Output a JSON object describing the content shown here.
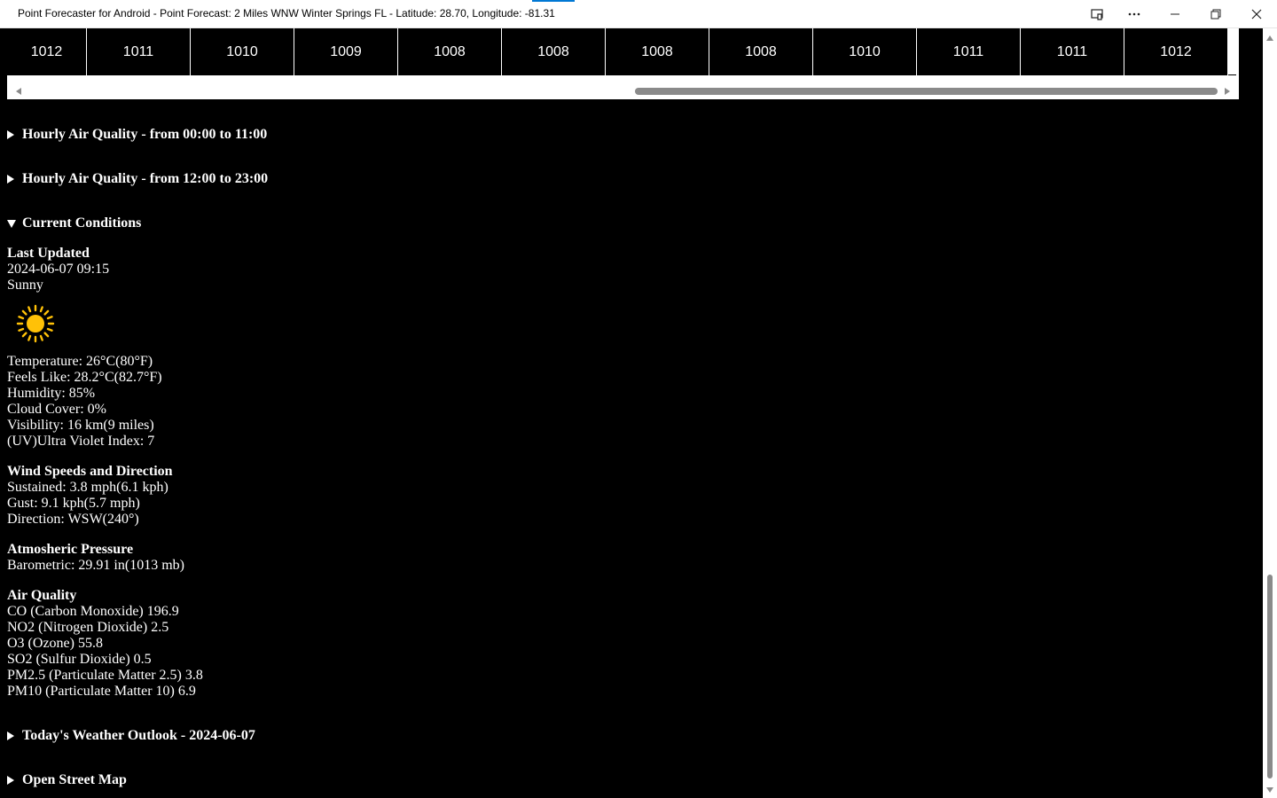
{
  "window": {
    "title": "Point Forecaster for Android - Point Forecast: 2 Miles WNW Winter Springs FL - Latitude: 28.70, Longitude: -81.31",
    "icons": [
      "cast-icon",
      "more-icon",
      "minimize-icon",
      "restore-icon",
      "close-icon"
    ]
  },
  "pressure_row": [
    "1012",
    "1011",
    "1010",
    "1009",
    "1008",
    "1008",
    "1008",
    "1008",
    "1010",
    "1011",
    "1011",
    "1012"
  ],
  "sections": {
    "air_quality_am": "Hourly Air Quality - from 00:00 to 11:00",
    "air_quality_pm": "Hourly Air Quality - from 12:00 to 23:00",
    "current_conditions": "Current Conditions",
    "outlook": "Today's Weather Outlook - 2024-06-07",
    "map": "Open Street Map"
  },
  "current": {
    "last_updated_label": "Last Updated",
    "last_updated": "2024-06-07 09:15",
    "condition": "Sunny",
    "condition_icon": "sun-icon",
    "temperature": "Temperature: 26°C(80°F)",
    "feels_like": "Feels Like: 28.2°C(82.7°F)",
    "humidity": "Humidity: 85%",
    "cloud_cover": "Cloud Cover: 0%",
    "visibility": "Visibility: 16 km(9 miles)",
    "uv": "(UV)Ultra Violet Index: 7",
    "wind_heading": "Wind Speeds and Direction",
    "sustained": "Sustained: 3.8 mph(6.1 kph)",
    "gust": "Gust: 9.1 kph(5.7 mph)",
    "direction": "Direction: WSW(240°)",
    "pressure_heading": "Atmosheric Pressure",
    "barometric": "Barometric: 29.91 in(1013 mb)",
    "aq_heading": "Air Quality",
    "co": "CO (Carbon Monoxide) 196.9",
    "no2": "NO2 (Nitrogen Dioxide) 2.5",
    "o3": "O3 (Ozone) 55.8",
    "so2": "SO2 (Sulfur Dioxide) 0.5",
    "pm25": "PM2.5 (Particulate Matter 2.5) 3.8",
    "pm10": "PM10 (Particulate Matter 10) 6.9"
  },
  "colors": {
    "background": "#000000",
    "text": "#ffffff",
    "sun": "#ffc107",
    "accent": "#0078d4"
  }
}
